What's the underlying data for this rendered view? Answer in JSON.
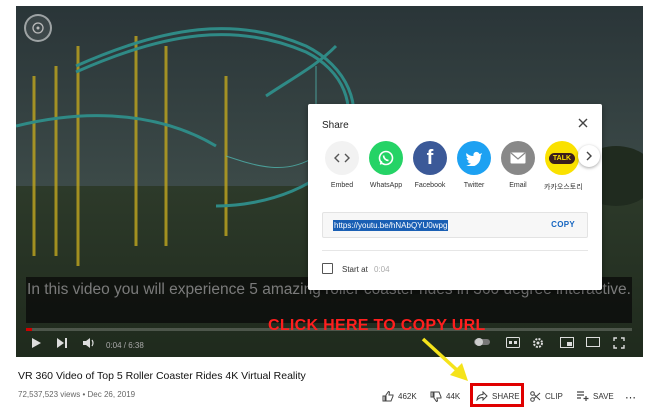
{
  "video": {
    "caption": "In this video you will experience 5 amazing roller coaster rides in 360 degree interactive.",
    "time": "0:04 / 6:38",
    "progress": 0.01
  },
  "share_dialog": {
    "title": "Share",
    "targets": [
      {
        "label": "Embed",
        "icon": "embed-icon",
        "color": "#f2f2f2"
      },
      {
        "label": "WhatsApp",
        "icon": "whatsapp-icon",
        "color": "#25d366"
      },
      {
        "label": "Facebook",
        "icon": "facebook-icon",
        "color": "#3b5998"
      },
      {
        "label": "Twitter",
        "icon": "twitter-icon",
        "color": "#1da1f2"
      },
      {
        "label": "Email",
        "icon": "email-icon",
        "color": "#888888"
      },
      {
        "label": "카카오스토리",
        "icon": "kakaotalk-icon",
        "color": "#fae100",
        "badge": "TALK"
      }
    ],
    "url": "https://youtu.be/hNAbQYU0wpg",
    "copy_label": "COPY",
    "start_at_label": "Start at",
    "start_at_time": "0:04"
  },
  "annotation": {
    "text": "CLICK HERE TO COPY URL",
    "color": "#ff1e1e"
  },
  "below": {
    "title": "VR 360 Video of Top 5 Roller Coaster Rides 4K Virtual Reality",
    "views_date": "72,537,523 views • Dec 26, 2019",
    "likes": "462K",
    "dislikes": "44K",
    "share": "SHARE",
    "clip": "CLIP",
    "save": "SAVE"
  }
}
